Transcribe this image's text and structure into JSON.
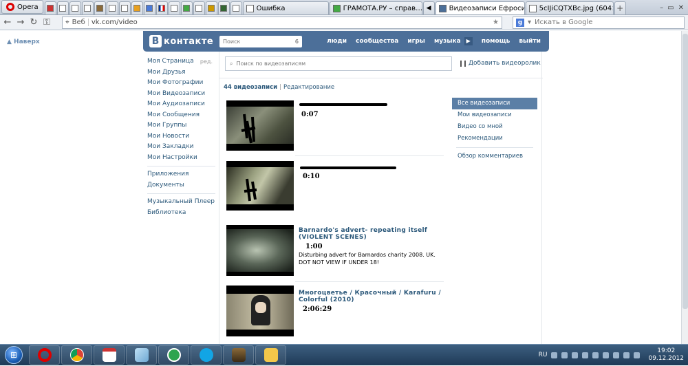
{
  "browser": {
    "opera_label": "Opera",
    "tabs": [
      {
        "label": "Ошибка",
        "active": false
      },
      {
        "label": "ГРАМОТА.РУ – справ…",
        "active": false
      },
      {
        "label": "Видеозаписи Ефросин…",
        "active": true
      },
      {
        "label": "5cIJiCQTXBc.jpg (604×…",
        "active": false
      }
    ],
    "address": {
      "web_label": "Веб",
      "url": "vk.com/video"
    },
    "search_placeholder": "Искать в Google",
    "colors": {
      "chrome": "#d6dde6",
      "taskbar": "#2a4a6b"
    }
  },
  "vk": {
    "back_label": "▲ Наверх",
    "logo_text": "контакте",
    "logo_letter": "В",
    "search": {
      "placeholder": "Поиск",
      "count": "6"
    },
    "nav": [
      "люди",
      "сообщества",
      "игры",
      "музыка",
      "помощь",
      "выйти"
    ],
    "colors": {
      "header": "#4c6f99",
      "link": "#2b587a",
      "active_menu": "#5b7fa6"
    },
    "left_menu": {
      "group1": [
        "Моя Страница",
        "Мои Друзья",
        "Мои Фотографии",
        "Мои Видеозаписи",
        "Мои Аудиозаписи",
        "Мои Сообщения",
        "Мои Группы",
        "Мои Новости",
        "Мои Закладки",
        "Мои Настройки"
      ],
      "edit_label": "ред.",
      "group2": [
        "Приложения",
        "Документы"
      ],
      "group3": [
        "Музыкальный Плеер",
        "Библиотека"
      ]
    },
    "video_search_placeholder": "Поиск по видеозаписям",
    "add_video_label": "Добавить видеоролик",
    "summary": {
      "count": "44 видеозаписи",
      "separator": "|",
      "edit": "Редактирование"
    },
    "right_menu": {
      "items": [
        "Все видеозаписи",
        "Мои видеозаписи",
        "Видео со мной",
        "Рекомендации"
      ],
      "comments": "Обзор комментариев"
    },
    "videos": [
      {
        "title": "…",
        "duration": "0:07",
        "description": ""
      },
      {
        "title": "…",
        "duration": "0:10",
        "description": ""
      },
      {
        "title": "Barnardo's advert- repeating itself (VIOLENT SCENES)",
        "duration": "1:00",
        "description": "Disturbing advert for Barnardos charity 2008. UK. DOT NOT VIEW IF UNDER 18!"
      },
      {
        "title": "Многоцветье / Красочный / Karafuru / Colorful (2010)",
        "duration": "2:06:29",
        "description": ""
      }
    ]
  },
  "taskbar": {
    "lang": "RU",
    "time": "19:02",
    "date": "09.12.2012",
    "apps": [
      "opera-icon",
      "chrome-icon",
      "calendar-icon",
      "notes-icon",
      "mail-agent-icon",
      "skype-icon",
      "media-icon",
      "folder-icon"
    ]
  }
}
